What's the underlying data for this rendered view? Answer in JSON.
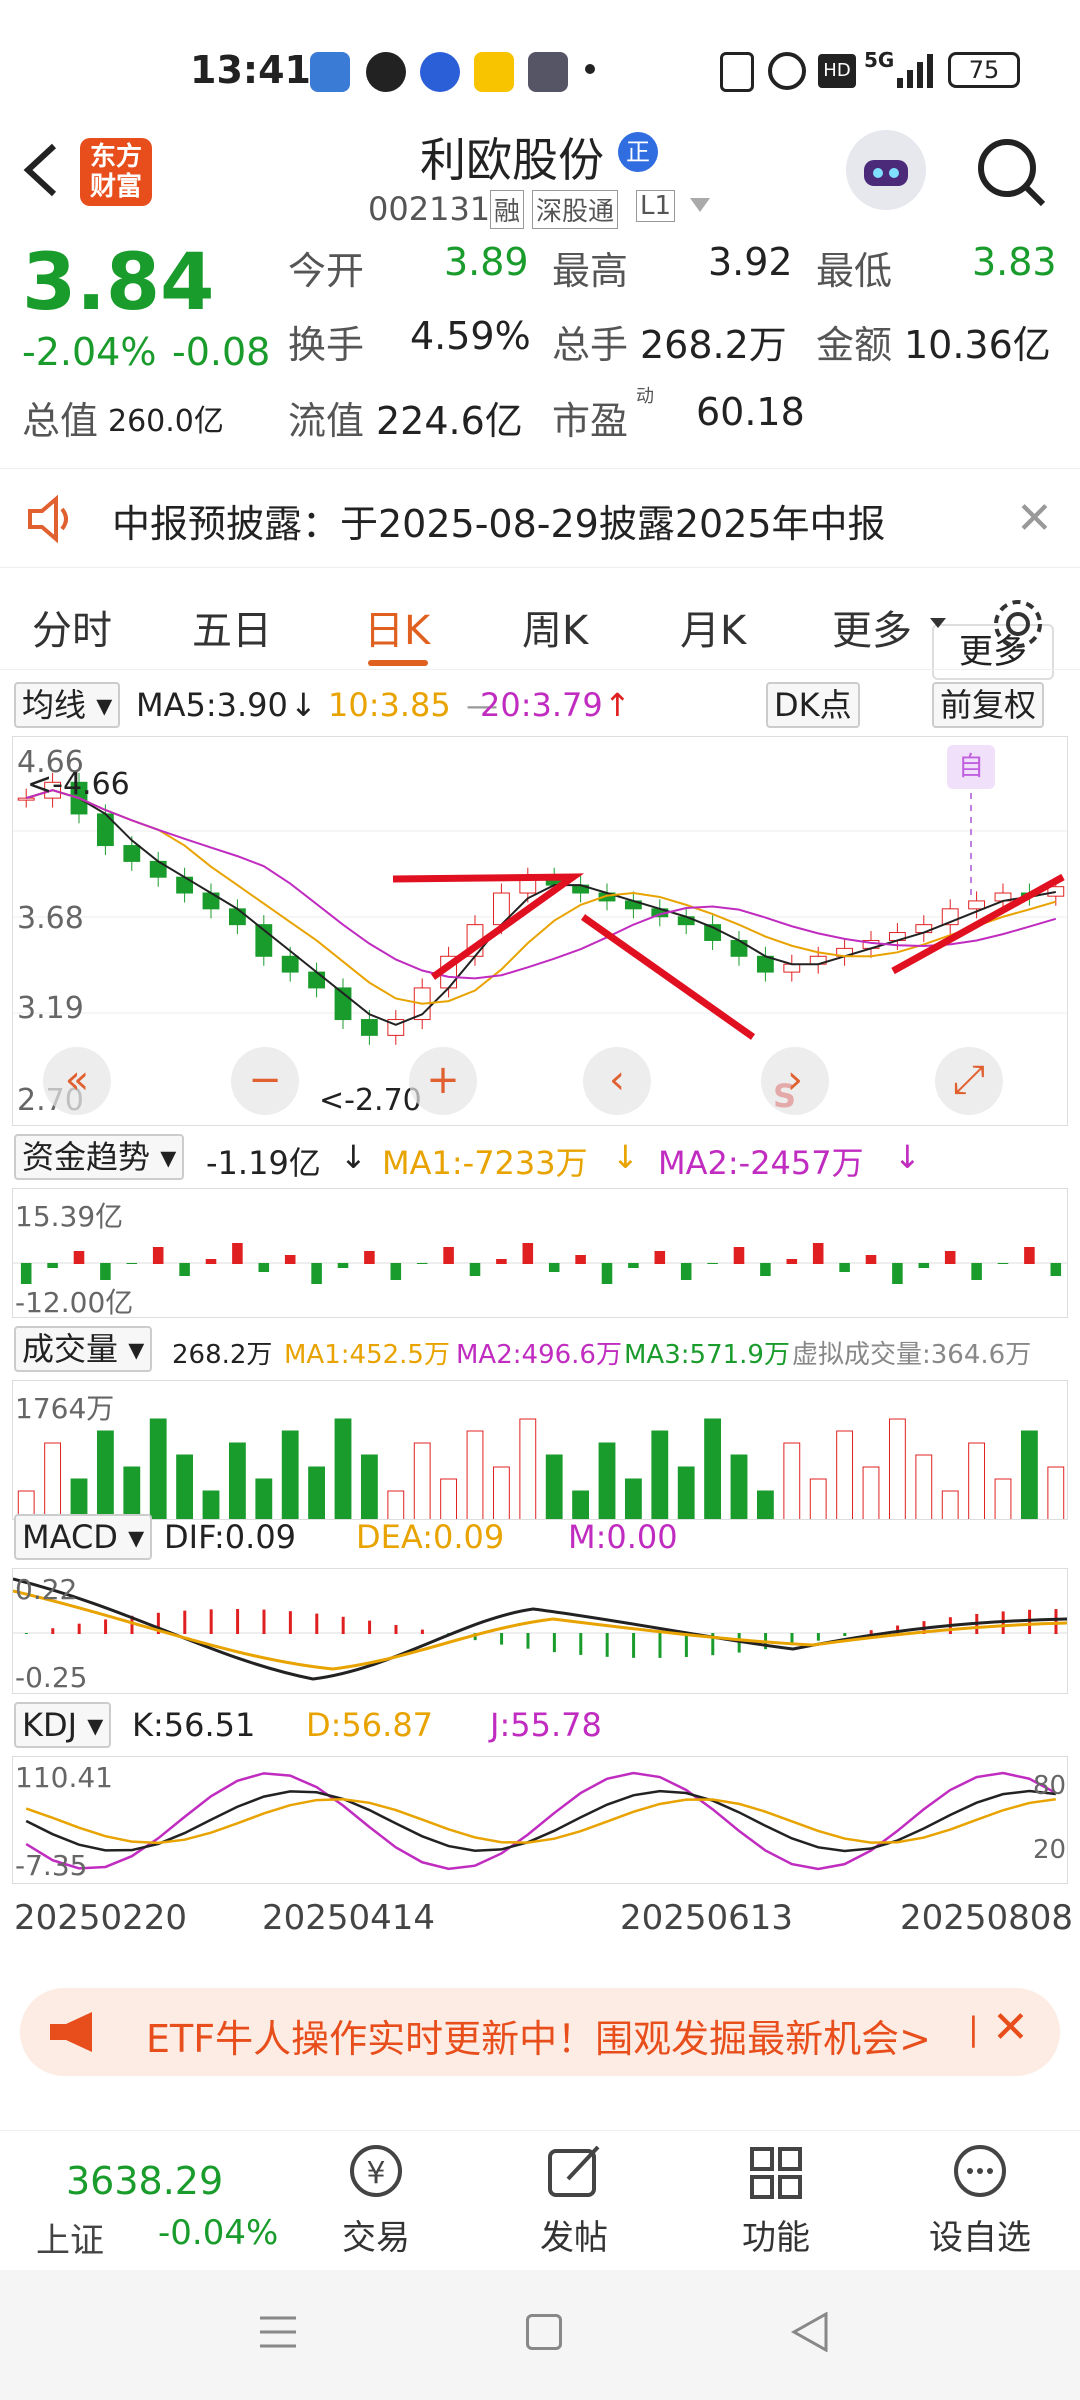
{
  "status": {
    "time": "13:41",
    "battery": "75",
    "network": "5G"
  },
  "header": {
    "logo_line1": "东方",
    "logo_line2": "财富",
    "stock_name": "利欧股份",
    "badge": "正",
    "code": "002131",
    "tag1": "融",
    "tag2": "深股通",
    "tag3": "L1"
  },
  "quote": {
    "price": "3.84",
    "change_pct": "-2.04%",
    "change": "-0.08",
    "open_label": "今开",
    "open": "3.89",
    "high_label": "最高",
    "high": "3.92",
    "low_label": "最低",
    "low": "3.83",
    "turnover_label": "换手",
    "turnover": "4.59%",
    "volume_label": "总手",
    "volume": "268.2万",
    "amount_label": "金额",
    "amount": "10.36亿",
    "mktcap_label": "总值",
    "mktcap": "260.0亿",
    "float_label": "流值",
    "float": "224.6亿",
    "pe_label": "市盈",
    "pe_sup": "动",
    "pe": "60.18",
    "more": "更多"
  },
  "notice": {
    "text": "中报预披露：于2025-08-29披露2025年中报"
  },
  "tabs": [
    "分时",
    "五日",
    "日K",
    "周K",
    "月K",
    "更多"
  ],
  "active_tab": "日K",
  "ma_row": {
    "select": "均线",
    "ma5": "MA5:3.90",
    "ma10": "10:3.85",
    "ma20": "20:3.79",
    "dk": "DK点",
    "adj": "前复权"
  },
  "kchart": {
    "y_labels": [
      "4.66",
      "3.68",
      "3.19",
      "2.70"
    ],
    "max_label": "<-4.66",
    "min_label": "<-2.70",
    "zi": "自",
    "s_mark": "S"
  },
  "fund": {
    "select": "资金趋势",
    "value": "-1.19亿",
    "ma1": "MA1:-7233万",
    "ma2": "MA2:-2457万",
    "y_top": "15.39亿",
    "y_bottom": "-12.00亿"
  },
  "vol": {
    "select": "成交量",
    "value": "268.2万",
    "ma1": "MA1:452.5万",
    "ma2": "MA2:496.6万",
    "ma3": "MA3:571.9万",
    "virtual": "虚拟成交量:364.6万",
    "y_top": "1764万"
  },
  "macd": {
    "select": "MACD",
    "dif": "DIF:0.09",
    "dea": "DEA:0.09",
    "m": "M:0.00",
    "y_top": "0.22",
    "y_bottom": "-0.25"
  },
  "kdj": {
    "select": "KDJ",
    "k": "K:56.51",
    "d": "D:56.87",
    "j": "J:55.78",
    "y_top": "110.41",
    "y_bottom": "-7.35",
    "r80": "80",
    "r20": "20"
  },
  "dates": [
    "20250220",
    "20250414",
    "20250613",
    "20250808"
  ],
  "banner": {
    "text": "ETF牛人操作实时更新中！围观发掘最新机会>"
  },
  "bottom": {
    "index_value": "3638.29",
    "index_name": "上证",
    "index_change": "-0.04%",
    "trade": "交易",
    "post": "发帖",
    "func": "功能",
    "watch": "设自选"
  },
  "chart_data": {
    "type": "candlestick",
    "x_ticks": [
      "20250220",
      "20250414",
      "20250613",
      "20250808"
    ],
    "y_ticks": [
      "4.66",
      "3.68",
      "3.19",
      "2.70"
    ],
    "max_price": 4.66,
    "min_price": 2.7,
    "close": [
      4.4,
      4.5,
      4.3,
      4.1,
      4.0,
      3.9,
      3.8,
      3.7,
      3.6,
      3.4,
      3.3,
      3.2,
      3.0,
      2.9,
      3.0,
      3.2,
      3.4,
      3.6,
      3.8,
      3.9,
      3.85,
      3.8,
      3.75,
      3.7,
      3.65,
      3.6,
      3.5,
      3.4,
      3.3,
      3.35,
      3.4,
      3.45,
      3.5,
      3.55,
      3.6,
      3.7,
      3.75,
      3.8,
      3.78,
      3.84
    ]
  }
}
